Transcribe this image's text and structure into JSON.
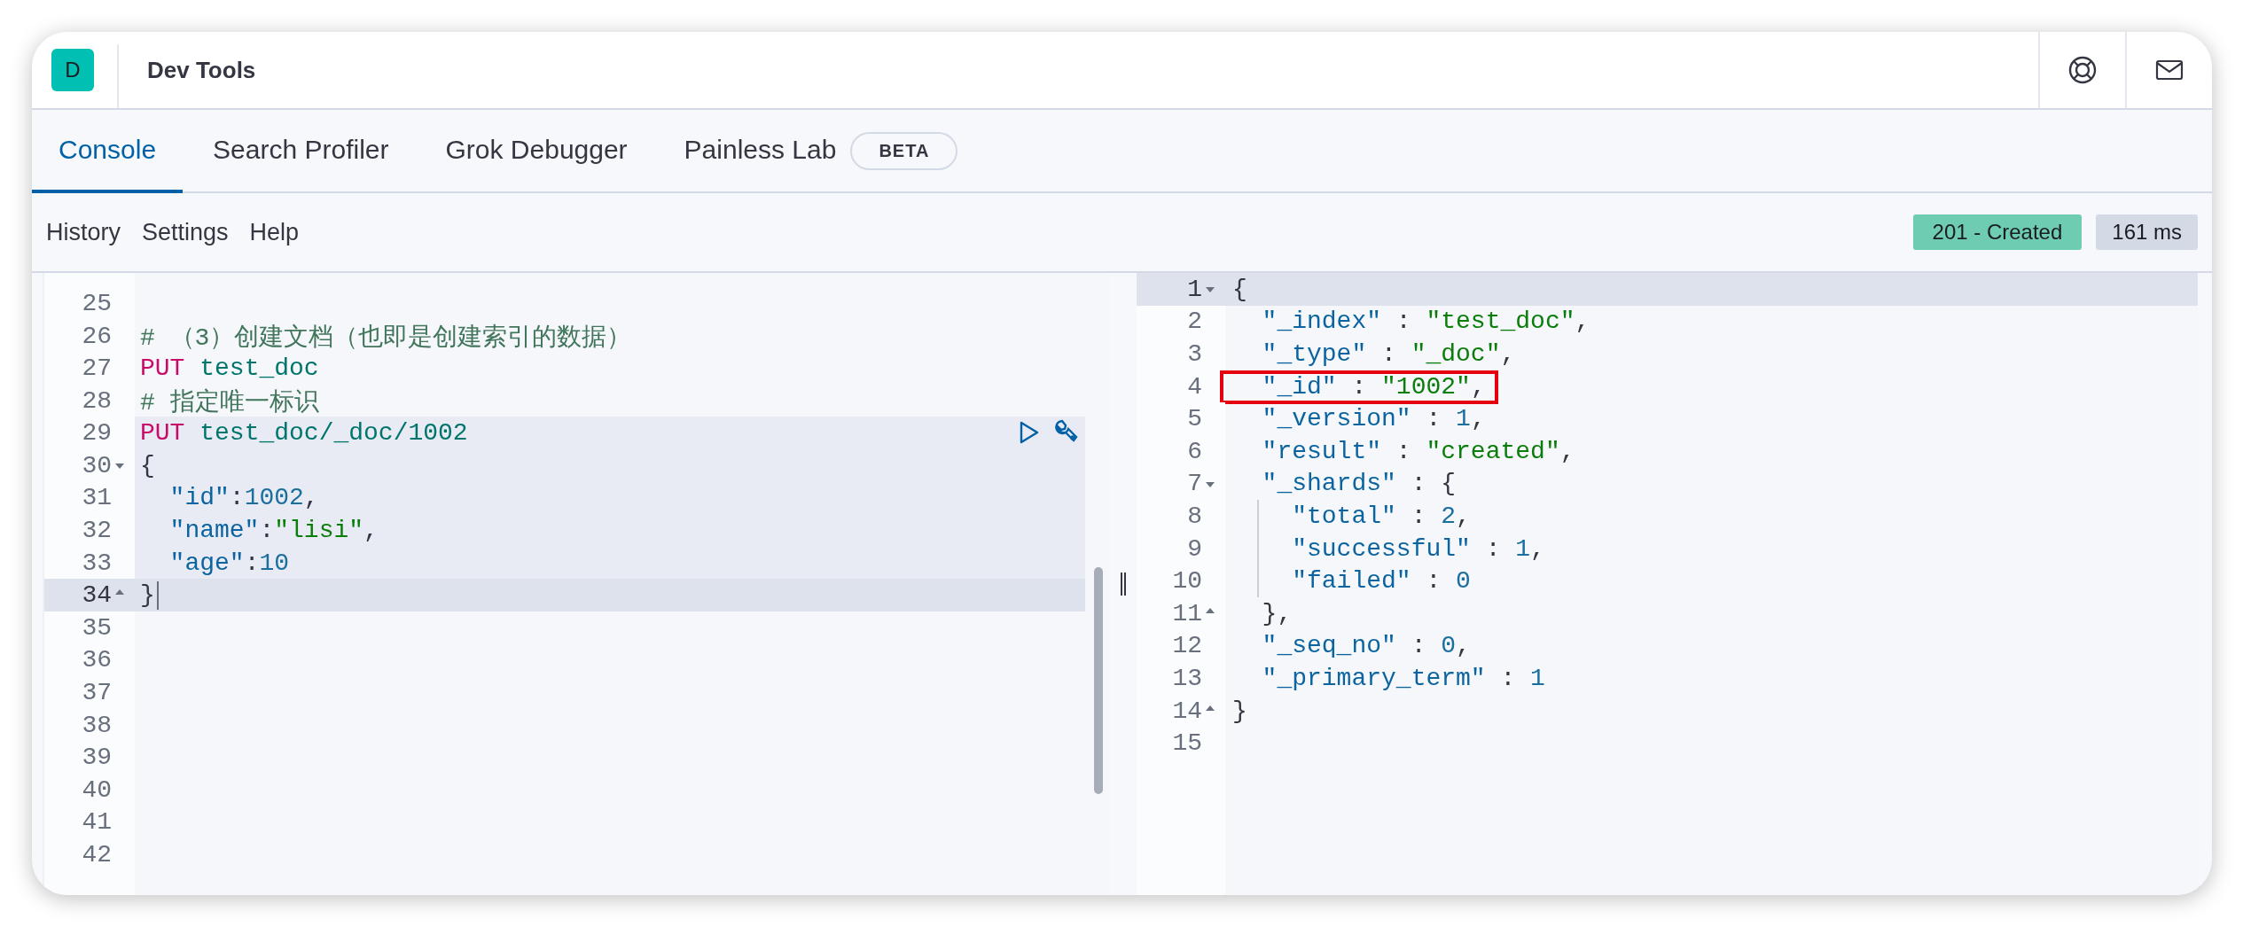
{
  "header": {
    "logo_letter": "D",
    "title": "Dev Tools"
  },
  "tabs": [
    {
      "label": "Console",
      "selected": true
    },
    {
      "label": "Search Profiler",
      "selected": false
    },
    {
      "label": "Grok Debugger",
      "selected": false
    },
    {
      "label": "Painless Lab",
      "selected": false,
      "badge": "BETA"
    }
  ],
  "toolbar": {
    "menu": [
      "History",
      "Settings",
      "Help"
    ],
    "status": "201 - Created",
    "duration": "161 ms"
  },
  "request_editor": {
    "lines": [
      {
        "number": "25"
      },
      {
        "number": "26",
        "tokens": [
          {
            "kind": "comment",
            "text": "# （3）创建文档（也即是创建索引的数据）"
          }
        ]
      },
      {
        "number": "27",
        "tokens": [
          {
            "kind": "method",
            "text": "PUT"
          },
          {
            "kind": "url",
            "text": " test_doc"
          }
        ]
      },
      {
        "number": "28",
        "tokens": [
          {
            "kind": "comment",
            "text": "# 指定唯一标识"
          }
        ]
      },
      {
        "number": "29",
        "in_request": true,
        "actions": true,
        "tokens": [
          {
            "kind": "method",
            "text": "PUT"
          },
          {
            "kind": "url",
            "text": " test_doc/_doc/1002"
          }
        ]
      },
      {
        "number": "30",
        "in_request": true,
        "fold_start": true,
        "tokens": [
          {
            "kind": "punct",
            "text": "{"
          }
        ]
      },
      {
        "number": "31",
        "in_request": true,
        "tokens": [
          {
            "kind": "key",
            "text": "  \"id\""
          },
          {
            "kind": "punct",
            "text": ":"
          },
          {
            "kind": "number",
            "text": "1002"
          },
          {
            "kind": "punct",
            "text": ","
          }
        ]
      },
      {
        "number": "32",
        "in_request": true,
        "tokens": [
          {
            "kind": "key",
            "text": "  \"name\""
          },
          {
            "kind": "punct",
            "text": ":"
          },
          {
            "kind": "string",
            "text": "\"lisi\""
          },
          {
            "kind": "punct",
            "text": ","
          }
        ]
      },
      {
        "number": "33",
        "in_request": true,
        "tokens": [
          {
            "kind": "key",
            "text": "  \"age\""
          },
          {
            "kind": "punct",
            "text": ":"
          },
          {
            "kind": "number",
            "text": "10"
          }
        ]
      },
      {
        "number": "34",
        "in_request": true,
        "active": true,
        "fold_end": true,
        "cursor": true,
        "tokens": [
          {
            "kind": "punct",
            "text": "}"
          }
        ]
      },
      {
        "number": "35"
      },
      {
        "number": "36"
      },
      {
        "number": "37"
      },
      {
        "number": "38"
      },
      {
        "number": "39"
      },
      {
        "number": "40"
      },
      {
        "number": "41"
      },
      {
        "number": "42"
      }
    ]
  },
  "response_editor": {
    "lines": [
      {
        "number": "1",
        "active": true,
        "fold_start": true,
        "tokens": [
          {
            "kind": "punct",
            "text": "{"
          }
        ]
      },
      {
        "number": "2",
        "tokens": [
          {
            "kind": "key",
            "text": "  \"_index\""
          },
          {
            "kind": "punct",
            "text": " : "
          },
          {
            "kind": "string",
            "text": "\"test_doc\""
          },
          {
            "kind": "punct",
            "text": ","
          }
        ]
      },
      {
        "number": "3",
        "tokens": [
          {
            "kind": "key",
            "text": "  \"_type\""
          },
          {
            "kind": "punct",
            "text": " : "
          },
          {
            "kind": "string",
            "text": "\"_doc\""
          },
          {
            "kind": "punct",
            "text": ","
          }
        ]
      },
      {
        "number": "4",
        "highlight": true,
        "tokens": [
          {
            "kind": "key",
            "text": "  \"_id\""
          },
          {
            "kind": "punct",
            "text": " : "
          },
          {
            "kind": "string",
            "text": "\"1002\""
          },
          {
            "kind": "punct",
            "text": ","
          }
        ]
      },
      {
        "number": "5",
        "tokens": [
          {
            "kind": "key",
            "text": "  \"_version\""
          },
          {
            "kind": "punct",
            "text": " : "
          },
          {
            "kind": "number",
            "text": "1"
          },
          {
            "kind": "punct",
            "text": ","
          }
        ]
      },
      {
        "number": "6",
        "tokens": [
          {
            "kind": "key",
            "text": "  \"result\""
          },
          {
            "kind": "punct",
            "text": " : "
          },
          {
            "kind": "string",
            "text": "\"created\""
          },
          {
            "kind": "punct",
            "text": ","
          }
        ]
      },
      {
        "number": "7",
        "fold_start": true,
        "tokens": [
          {
            "kind": "key",
            "text": "  \"_shards\""
          },
          {
            "kind": "punct",
            "text": " : {"
          }
        ]
      },
      {
        "number": "8",
        "guide": true,
        "tokens": [
          {
            "kind": "key",
            "text": "    \"total\""
          },
          {
            "kind": "punct",
            "text": " : "
          },
          {
            "kind": "number",
            "text": "2"
          },
          {
            "kind": "punct",
            "text": ","
          }
        ]
      },
      {
        "number": "9",
        "guide": true,
        "tokens": [
          {
            "kind": "key",
            "text": "    \"successful\""
          },
          {
            "kind": "punct",
            "text": " : "
          },
          {
            "kind": "number",
            "text": "1"
          },
          {
            "kind": "punct",
            "text": ","
          }
        ]
      },
      {
        "number": "10",
        "guide": true,
        "tokens": [
          {
            "kind": "key",
            "text": "    \"failed\""
          },
          {
            "kind": "punct",
            "text": " : "
          },
          {
            "kind": "number",
            "text": "0"
          }
        ]
      },
      {
        "number": "11",
        "fold_end": true,
        "tokens": [
          {
            "kind": "punct",
            "text": "  },"
          }
        ]
      },
      {
        "number": "12",
        "tokens": [
          {
            "kind": "key",
            "text": "  \"_seq_no\""
          },
          {
            "kind": "punct",
            "text": " : "
          },
          {
            "kind": "number",
            "text": "0"
          },
          {
            "kind": "punct",
            "text": ","
          }
        ]
      },
      {
        "number": "13",
        "tokens": [
          {
            "kind": "key",
            "text": "  \"_primary_term\""
          },
          {
            "kind": "punct",
            "text": " : "
          },
          {
            "kind": "number",
            "text": "1"
          }
        ]
      },
      {
        "number": "14",
        "fold_end": true,
        "tokens": [
          {
            "kind": "punct",
            "text": "}"
          }
        ]
      },
      {
        "number": "15"
      }
    ]
  }
}
